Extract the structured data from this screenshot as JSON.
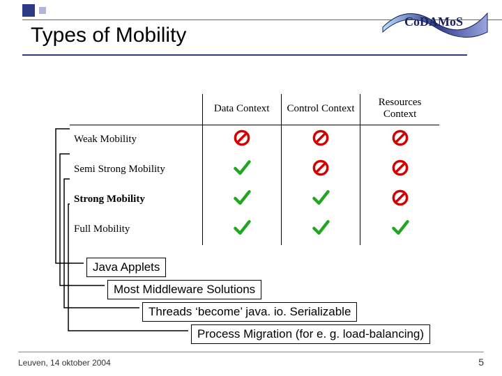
{
  "title": "Types of Mobility",
  "logo_text": "CoDAMoS",
  "table": {
    "columns": [
      "Data Context",
      "Control Context",
      "Resources Context"
    ],
    "rows": [
      {
        "label": "Weak Mobility",
        "cells": [
          "no",
          "no",
          "no"
        ]
      },
      {
        "label": "Semi Strong Mobility",
        "cells": [
          "yes",
          "no",
          "no"
        ]
      },
      {
        "label": "Strong Mobility",
        "cells": [
          "yes",
          "yes",
          "no"
        ],
        "bold": true
      },
      {
        "label": "Full Mobility",
        "cells": [
          "yes",
          "yes",
          "yes"
        ]
      }
    ]
  },
  "captions": [
    "Java Applets",
    "Most Middleware Solutions",
    "Threads ‘become’ java. io. Serializable",
    "Process Migration (for e. g. load-balancing)"
  ],
  "footer": {
    "left": "Leuven, 14 oktober 2004",
    "page": "5"
  },
  "icons": {
    "yes": {
      "type": "check",
      "stroke": "#22a522"
    },
    "no": {
      "type": "prohibit",
      "stroke": "#d40000"
    }
  },
  "chart_data": {
    "type": "table",
    "title": "Types of Mobility",
    "row_labels": [
      "Weak Mobility",
      "Semi Strong Mobility",
      "Strong Mobility",
      "Full Mobility"
    ],
    "col_labels": [
      "Data Context",
      "Control Context",
      "Resources Context"
    ],
    "values": [
      [
        false,
        false,
        false
      ],
      [
        true,
        false,
        false
      ],
      [
        true,
        true,
        false
      ],
      [
        true,
        true,
        true
      ]
    ],
    "annotations": {
      "Weak Mobility": "Java Applets",
      "Semi Strong Mobility": "Most Middleware Solutions",
      "Strong Mobility": "Threads ‘become’ java.io.Serializable",
      "Full Mobility": "Process Migration (for e.g. load-balancing)"
    }
  }
}
